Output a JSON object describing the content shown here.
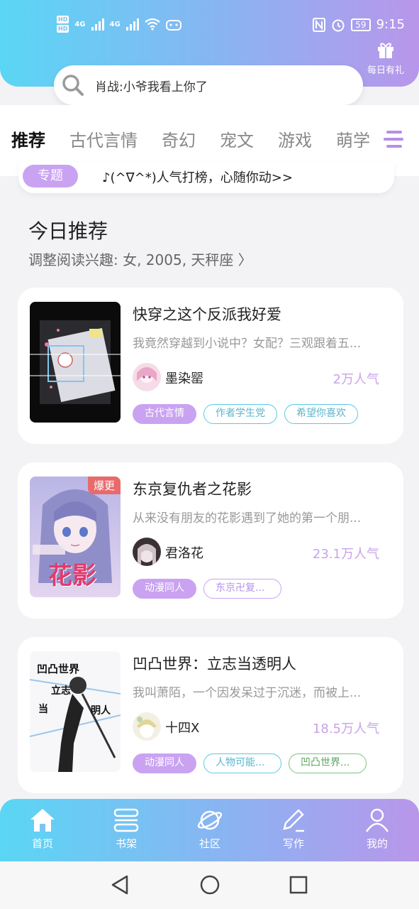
{
  "status_bar": {
    "hd1": "HD",
    "hd2": "HD",
    "net1": "4G",
    "net2": "4G",
    "battery": "59",
    "time": "9:15"
  },
  "gift": {
    "label": "每日有礼"
  },
  "search": {
    "text": "肖战:小爷我看上你了"
  },
  "tabs": [
    "推荐",
    "古代言情",
    "奇幻",
    "宠文",
    "游戏",
    "萌学"
  ],
  "topic": {
    "badge": "专题",
    "text": "♪(^∇^*)人气打榜，心随你动>>"
  },
  "section": {
    "title": "今日推荐",
    "subtitle": "调整阅读兴趣: 女, 2005, 天秤座 〉"
  },
  "books": [
    {
      "title": "快穿之这个反派我好爱",
      "desc": "我竟然穿越到小说中？女配？三观跟着五...",
      "author": "墨染罂",
      "popularity": "2万人气",
      "tags": [
        "古代言情",
        "作者学生党",
        "希望你喜欢"
      ]
    },
    {
      "title": "东京复仇者之花影",
      "desc": "从来没有朋友的花影遇到了她的第一个朋...",
      "author": "君洛花",
      "popularity": "23.1万人气",
      "badge": "爆更",
      "cover_text": "花影",
      "tags": [
        "动漫同人",
        "东京卍复..."
      ]
    },
    {
      "title": "凹凸世界：立志当透明人",
      "desc": "我叫萧陌，一个因发呆过于沉迷，而被上...",
      "author": "十四X",
      "popularity": "18.5万人气",
      "tags": [
        "动漫同人",
        "人物可能...",
        "凹凸世界..."
      ]
    }
  ],
  "bottom_nav": [
    "首页",
    "书架",
    "社区",
    "写作",
    "我的"
  ],
  "colors": {
    "gradient_start": "#5ad6f4",
    "gradient_end": "#b996ea",
    "accent_purple": "#c9a3f1",
    "hot_red": "#e86a6a"
  }
}
